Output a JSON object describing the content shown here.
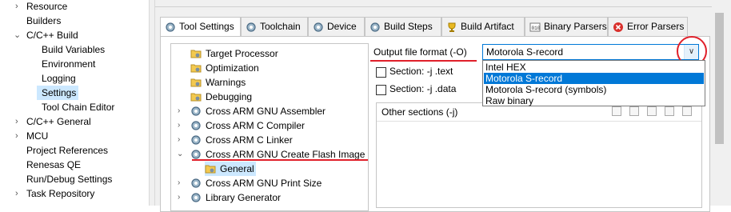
{
  "nav": {
    "items": [
      {
        "label": "Resource",
        "arrow": ">"
      },
      {
        "label": "Builders",
        "arrow": ""
      },
      {
        "label": "C/C++ Build",
        "arrow": "v"
      },
      {
        "label": "Build Variables",
        "arrow": ""
      },
      {
        "label": "Environment",
        "arrow": ""
      },
      {
        "label": "Logging",
        "arrow": ""
      },
      {
        "label": "Settings",
        "arrow": ""
      },
      {
        "label": "Tool Chain Editor",
        "arrow": ""
      },
      {
        "label": "C/C++ General",
        "arrow": ">"
      },
      {
        "label": "MCU",
        "arrow": ">"
      },
      {
        "label": "Project References",
        "arrow": ""
      },
      {
        "label": "Renesas QE",
        "arrow": ""
      },
      {
        "label": "Run/Debug Settings",
        "arrow": ""
      },
      {
        "label": "Task Repository",
        "arrow": ">"
      }
    ]
  },
  "tabs": [
    {
      "label": "Tool Settings"
    },
    {
      "label": "Toolchain"
    },
    {
      "label": "Device"
    },
    {
      "label": "Build Steps"
    },
    {
      "label": "Build Artifact"
    },
    {
      "label": "Binary Parsers"
    },
    {
      "label": "Error Parsers"
    }
  ],
  "settings_tree": {
    "items": [
      {
        "label": "Target Processor",
        "arrow": ""
      },
      {
        "label": "Optimization",
        "arrow": ""
      },
      {
        "label": "Warnings",
        "arrow": ""
      },
      {
        "label": "Debugging",
        "arrow": ""
      },
      {
        "label": "Cross ARM GNU Assembler",
        "arrow": ">"
      },
      {
        "label": "Cross ARM C Compiler",
        "arrow": ">"
      },
      {
        "label": "Cross ARM C Linker",
        "arrow": ">"
      },
      {
        "label": "Cross ARM GNU Create Flash Image",
        "arrow": "v"
      },
      {
        "label": "General",
        "arrow": ""
      },
      {
        "label": "Cross ARM GNU Print Size",
        "arrow": ">"
      },
      {
        "label": "Library Generator",
        "arrow": ">"
      }
    ]
  },
  "output_format": {
    "label": "Output file format (-O)",
    "selected": "Motorola S-record",
    "options": [
      "Intel HEX",
      "Motorola S-record",
      "Motorola S-record (symbols)",
      "Raw binary"
    ]
  },
  "sections": {
    "text_label": "Section: -j .text",
    "data_label": "Section: -j .data",
    "other_label": "Other sections (-j)"
  },
  "colors": {
    "selection": "#cce8ff",
    "list_selection": "#0078d7",
    "annotation_red": "#e0202a"
  }
}
